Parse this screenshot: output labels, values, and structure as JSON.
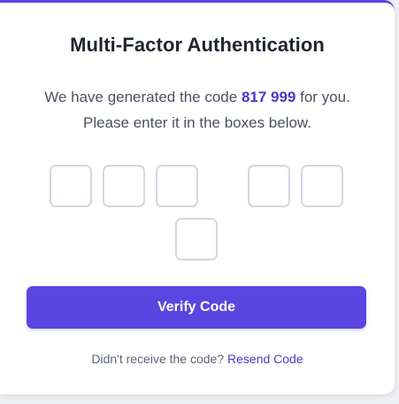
{
  "mfa": {
    "title": "Multi-Factor Authentication",
    "message_prefix": "We have generated the code ",
    "code": "817 999",
    "message_suffix": " for you. Please enter it in the boxes below.",
    "otp_digits": [
      "",
      "",
      "",
      "",
      "",
      ""
    ],
    "verify_label": "Verify Code",
    "resend_prompt": "Didn't receive the code? ",
    "resend_link": "Resend Code"
  },
  "colors": {
    "accent": "#5b45e0",
    "code_text": "#4f37c8",
    "box_border": "#d3d8e0"
  }
}
